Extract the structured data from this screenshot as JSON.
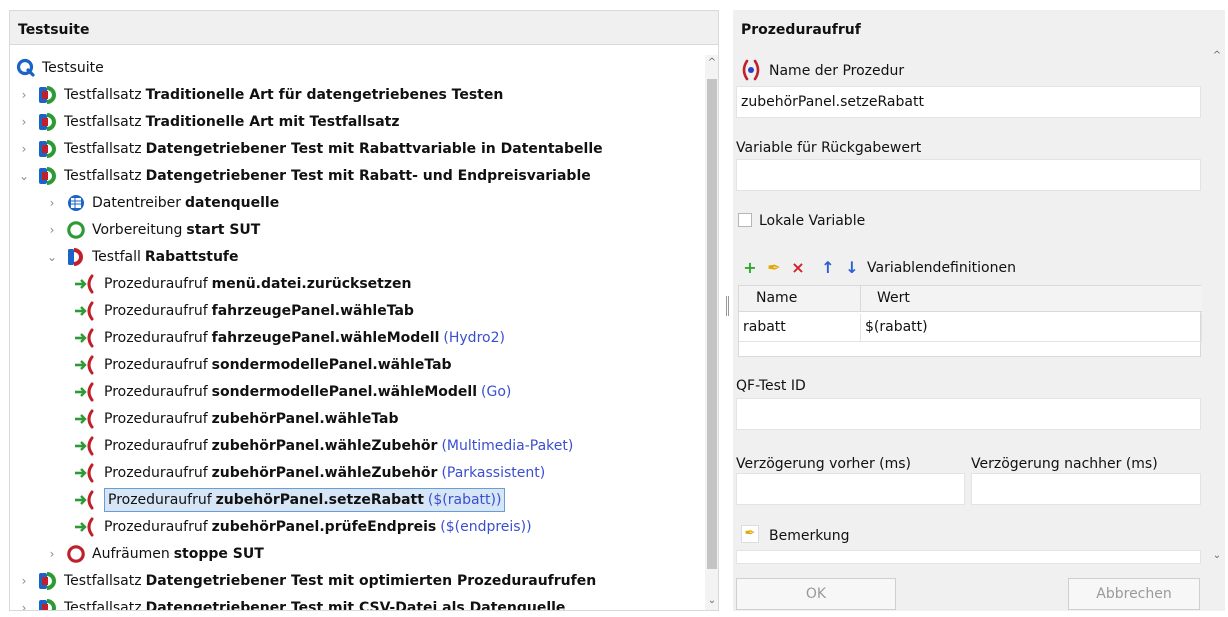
{
  "left_panel": {
    "title": "Testsuite",
    "tree": [
      {
        "label": "Testsuite",
        "name": "",
        "param": "",
        "icon": "testsuite-icon"
      },
      {
        "label": "Testfallsatz",
        "name": "Traditionelle Art für datengetriebenes Testen",
        "param": "",
        "icon": "testset-icon"
      },
      {
        "label": "Testfallsatz",
        "name": "Traditionelle Art mit Testfallsatz",
        "param": "",
        "icon": "testset-icon"
      },
      {
        "label": "Testfallsatz",
        "name": "Datengetriebener Test mit Rabattvariable in Datentabelle",
        "param": "",
        "icon": "testset-icon"
      },
      {
        "label": "Testfallsatz",
        "name": "Datengetriebener Test mit Rabatt- und Endpreisvariable",
        "param": "",
        "icon": "testset-icon"
      },
      {
        "label": "Datentreiber",
        "name": "datenquelle",
        "param": "",
        "icon": "datadriver-icon"
      },
      {
        "label": "Vorbereitung",
        "name": "start SUT",
        "param": "",
        "icon": "setup-icon"
      },
      {
        "label": "Testfall",
        "name": "Rabattstufe",
        "param": "",
        "icon": "testcase-icon"
      },
      {
        "label": "Prozeduraufruf",
        "name": "menü.datei.zurücksetzen",
        "param": "",
        "icon": "procedure-call-icon"
      },
      {
        "label": "Prozeduraufruf",
        "name": "fahrzeugePanel.wähleTab",
        "param": "",
        "icon": "procedure-call-icon"
      },
      {
        "label": "Prozeduraufruf",
        "name": "fahrzeugePanel.wähleModell",
        "param": "(Hydro2)",
        "icon": "procedure-call-icon"
      },
      {
        "label": "Prozeduraufruf",
        "name": "sondermodellePanel.wähleTab",
        "param": "",
        "icon": "procedure-call-icon"
      },
      {
        "label": "Prozeduraufruf",
        "name": "sondermodellePanel.wähleModell",
        "param": "(Go)",
        "icon": "procedure-call-icon"
      },
      {
        "label": "Prozeduraufruf",
        "name": "zubehörPanel.wähleTab",
        "param": "",
        "icon": "procedure-call-icon"
      },
      {
        "label": "Prozeduraufruf",
        "name": "zubehörPanel.wähleZubehör",
        "param": "(Multimedia-Paket)",
        "icon": "procedure-call-icon"
      },
      {
        "label": "Prozeduraufruf",
        "name": "zubehörPanel.wähleZubehör",
        "param": "(Parkassistent)",
        "icon": "procedure-call-icon"
      },
      {
        "label": "Prozeduraufruf",
        "name": "zubehörPanel.setzeRabatt",
        "param": "($(rabatt))",
        "icon": "procedure-call-icon"
      },
      {
        "label": "Prozeduraufruf",
        "name": "zubehörPanel.prüfeEndpreis",
        "param": "($(endpreis))",
        "icon": "procedure-call-icon"
      },
      {
        "label": "Aufräumen",
        "name": "stoppe SUT",
        "param": "",
        "icon": "cleanup-icon"
      },
      {
        "label": "Testfallsatz",
        "name": "Datengetriebener Test mit optimierten Prozeduraufrufen",
        "param": "",
        "icon": "testset-icon"
      },
      {
        "label": "Testfallsatz",
        "name": "Datengetriebener Test mit CSV-Datei als Datenquelle",
        "param": "",
        "icon": "testset-icon"
      }
    ]
  },
  "right_panel": {
    "title": "Prozeduraufruf",
    "procedure_name_label": "Name der Prozedur",
    "procedure_name_value": "zubehörPanel.setzeRabatt",
    "return_var_label": "Variable für Rückgabewert",
    "return_var_value": "",
    "local_var_label": "Lokale Variable",
    "vardefs_label": "Variablendefinitionen",
    "table_headers": [
      "Name",
      "Wert"
    ],
    "table_rows": [
      [
        "rabatt",
        "$(rabatt)"
      ]
    ],
    "qftest_id_label": "QF-Test ID",
    "delay_before_label": "Verzögerung vorher (ms)",
    "delay_after_label": "Verzögerung nachher (ms)",
    "comment_label": "Bemerkung",
    "ok_label": "OK",
    "cancel_label": "Abbrechen"
  },
  "colors": {
    "param_blue": "#3a4fd0",
    "selection_bg": "#d6e6f7",
    "panel_bg": "#f0f0f0"
  }
}
